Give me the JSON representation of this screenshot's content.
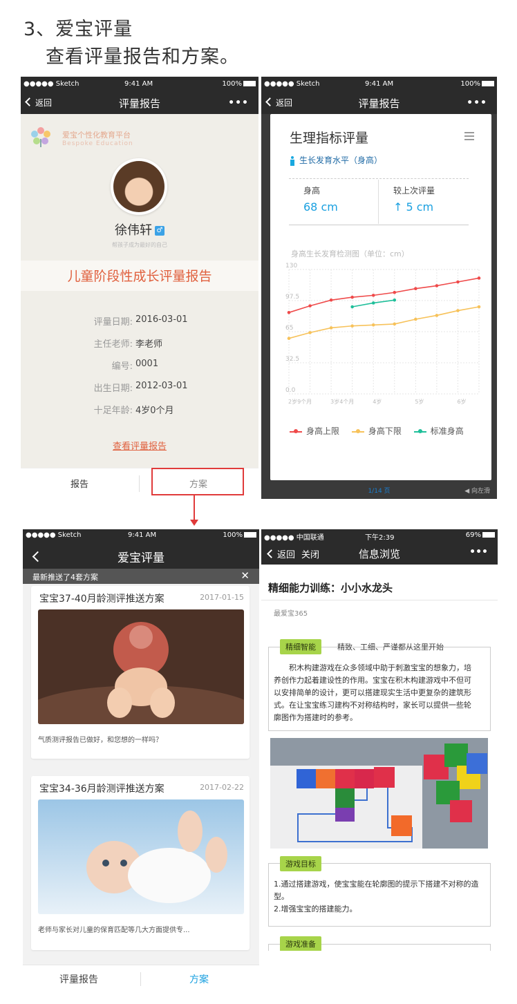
{
  "heading": {
    "title": "3、爱宝评量",
    "subtitle": "查看评量报告和方案。"
  },
  "status": {
    "carrier": "●●●●● Sketch",
    "time": "9:41 AM",
    "battery": "100%"
  },
  "screen1": {
    "back": "返回",
    "title": "评量报告",
    "more": "•••",
    "logo_text": "爱宝个性化教育平台",
    "logo_en": "Bespoke Education",
    "child_name": "徐伟轩",
    "gender_symbol": "♂",
    "slogan": "帮孩子成为最好的自己",
    "report_title": "儿童阶段性成长评量报告",
    "info": [
      {
        "label": "评量日期:",
        "value": "2016-03-01"
      },
      {
        "label": "主任老师:",
        "value": "李老师"
      },
      {
        "label": "编号:",
        "value": "0001"
      },
      {
        "label": "出生日期:",
        "value": "2012-03-01"
      },
      {
        "label": "十足年龄:",
        "value": "4岁0个月"
      }
    ],
    "view_link": "查看评量报告",
    "tabs": [
      "报告",
      "方案"
    ]
  },
  "screen2": {
    "back": "返回",
    "title": "评量报告",
    "more": "•••",
    "card_title": "生理指标评量",
    "subtitle": "生长发育水平（身高）",
    "metrics": [
      {
        "label": "身高",
        "value": "68 cm"
      },
      {
        "label": "较上次评量",
        "value": "↑ 5 cm"
      }
    ],
    "chart_caption": "身高生长发育检测图（单位：cm）",
    "pager": "1/14 页",
    "swipe_hint": "◀ 向左滑",
    "colors": {
      "upper": "#ef4a4a",
      "lower": "#f7c25a",
      "standard": "#1fbf9a"
    }
  },
  "chart_data": {
    "type": "line",
    "y_ticks": [
      "130",
      "97.5",
      "65",
      "32.5",
      "0.0"
    ],
    "ylim": [
      0,
      130
    ],
    "x_tick_labels": [
      "2岁9个月",
      "3岁4个月",
      "4岁",
      "5岁",
      "6岁"
    ],
    "x_points": 10,
    "series": [
      {
        "name": "身高上限",
        "values": [
          85,
          92,
          98,
          101,
          103,
          106,
          110,
          113,
          117,
          121
        ]
      },
      {
        "name": "身高下限",
        "values": [
          58,
          64,
          69,
          71,
          72,
          73,
          78,
          82,
          87,
          91
        ]
      },
      {
        "name": "标准身高",
        "start_index": 3,
        "values": [
          91,
          95,
          98
        ]
      }
    ],
    "grid": true,
    "legend_position": "bottom"
  },
  "screen3": {
    "title": "爱宝评量",
    "banner": "最新推送了4套方案",
    "banner_close": "✕",
    "cards": [
      {
        "title": "宝宝37-40月龄测评推送方案",
        "date": "2017-01-15",
        "desc": "气质测评报告已做好，和您想的一样吗？"
      },
      {
        "title": "宝宝34-36月龄测评推送方案",
        "date": "2017-02-22",
        "desc": "老师与家长对儿童的保育匹配等几大方面提供专..."
      }
    ],
    "tabs": [
      "评量报告",
      "方案"
    ]
  },
  "screen4": {
    "status": {
      "carrier": "●●●●● 中国联通",
      "time": "下午2:39",
      "battery": "69%"
    },
    "back": "返回",
    "close": "关闭",
    "title": "信息浏览",
    "more": "•••",
    "article_title": "精细能力训练：小小水龙头",
    "author": "最爱宝365",
    "section1_tag": "精细智能",
    "section1_head": "精致、工细、严谨都从这里开始",
    "section1_body": "积木构建游戏在众多领域中助于刺激宝宝的想象力，培养创作力起着建设性的作用。宝宝在积木构建游戏中不但可以安排简单的设计，更可以搭建现实生活中更复杂的建筑形式。在让宝宝练习建构不对称结构时，家长可以提供一些轮廓图作为搭建时的参考。",
    "section2_tag": "游戏目标",
    "goals": [
      "1.通过搭建游戏，使宝宝能在轮廓图的提示下搭建不对称的造型。",
      "2.增强宝宝的搭建能力。"
    ],
    "section3_tag": "游戏准备"
  }
}
